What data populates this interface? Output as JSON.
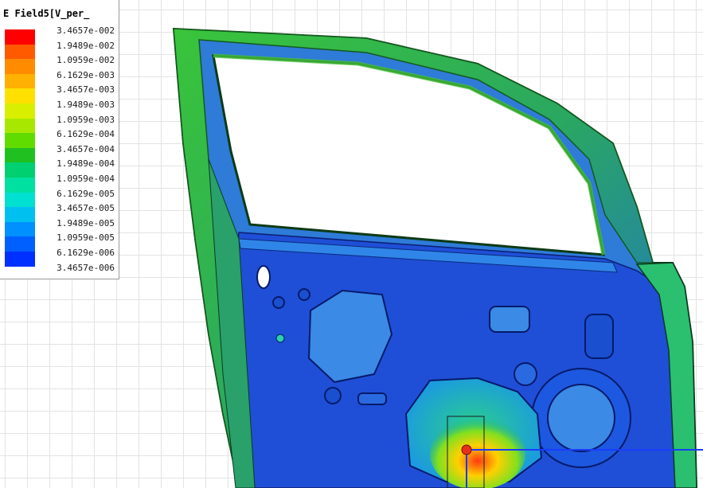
{
  "legend": {
    "title": "E Field5[V_per_",
    "labels": [
      "3.4657e-002",
      "1.9489e-002",
      "1.0959e-002",
      "6.1629e-003",
      "3.4657e-003",
      "1.9489e-003",
      "1.0959e-003",
      "6.1629e-004",
      "3.4657e-004",
      "1.9489e-004",
      "1.0959e-004",
      "6.1629e-005",
      "3.4657e-005",
      "1.9489e-005",
      "1.0959e-005",
      "6.1629e-006",
      "3.4657e-006"
    ],
    "swatch_colors": [
      "#ff0000",
      "#ff5a00",
      "#ff8c00",
      "#ffb000",
      "#ffe000",
      "#d8f000",
      "#a8e800",
      "#60dc00",
      "#20c020",
      "#00d070",
      "#00e0a0",
      "#00e0d0",
      "#00c0f0",
      "#0090ff",
      "#0060ff",
      "#0030ff"
    ]
  },
  "model": {
    "colors": {
      "frame_edge": "#1e8a2c",
      "frame_green": "#43c43a",
      "panel_blue": "#1f4fd6",
      "panel_deep": "#0a2ad0",
      "panel_light": "#3a8ae6",
      "hot_red": "#e83018",
      "axis_blue": "#1a3cff"
    }
  }
}
